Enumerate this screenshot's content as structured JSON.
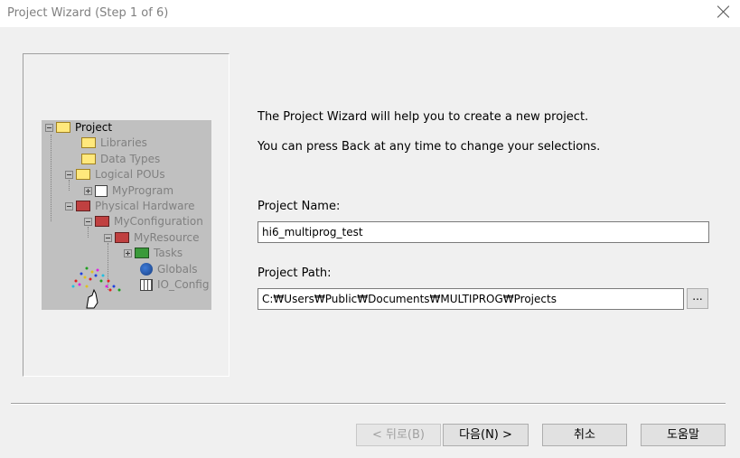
{
  "window": {
    "title": "Project Wizard (Step 1 of 6)"
  },
  "tree": {
    "root": "Project",
    "items": [
      "Libraries",
      "Data Types",
      "Logical POUs",
      "MyProgram",
      "Physical Hardware",
      "MyConfiguration",
      "MyResource",
      "Tasks",
      "Globals",
      "IO_Config"
    ]
  },
  "main": {
    "intro_line1": "The Project Wizard will help you to create a new project.",
    "intro_line2": "You can press Back at any time to change your selections.",
    "project_name_label": "Project Name:",
    "project_name_value": "hi6_multiprog_test",
    "project_path_label": "Project Path:",
    "project_path_value": "C:₩Users₩Public₩Documents₩MULTIPROG₩Projects",
    "browse_label": "..."
  },
  "buttons": {
    "back": "< 뒤로(B)",
    "next": "다음(N) >",
    "cancel": "취소",
    "help": "도움말"
  }
}
